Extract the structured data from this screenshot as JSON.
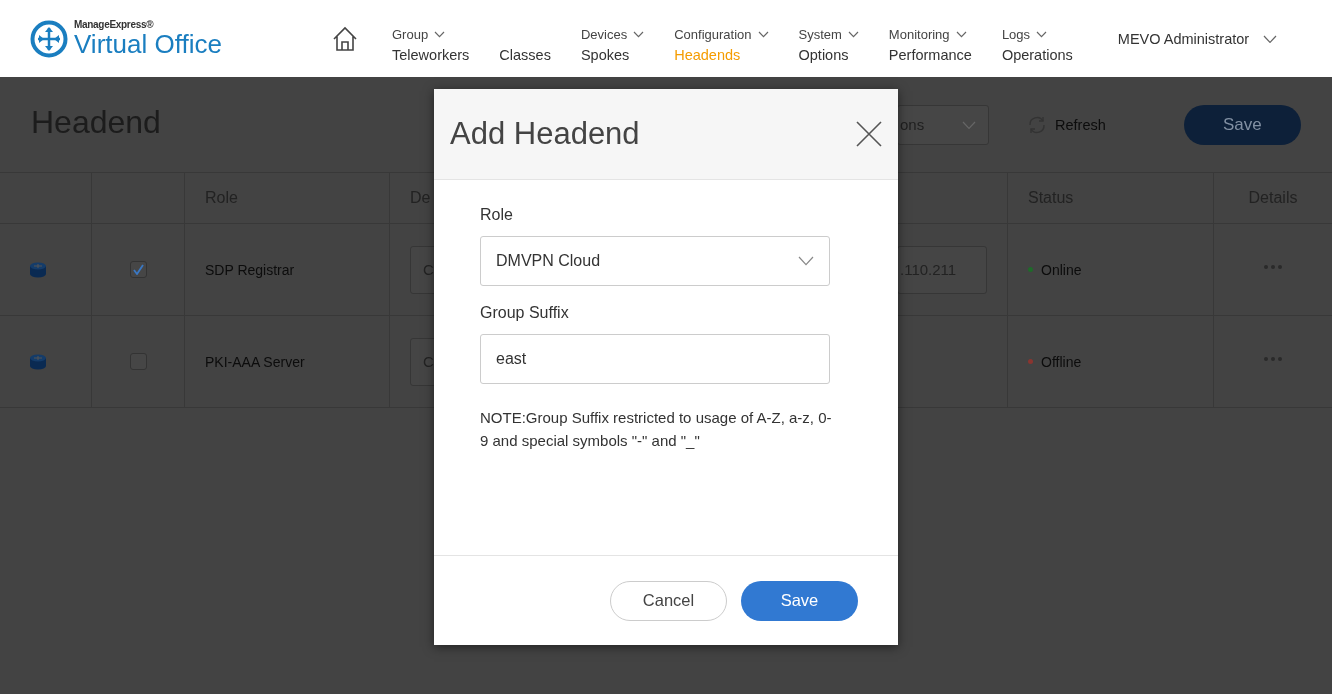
{
  "header": {
    "logo": {
      "brand": "ManageExpress®",
      "product": "Virtual Office"
    },
    "nav": [
      {
        "group": "Group",
        "label": "Teleworkers",
        "selected": false
      },
      {
        "label": "Classes",
        "selected": false
      },
      {
        "group": "Devices",
        "label": "Spokes",
        "selected": false
      },
      {
        "group": "Configuration",
        "label": "Headends",
        "selected": true
      },
      {
        "group": "System",
        "label": "Options",
        "selected": false
      },
      {
        "group": "Monitoring",
        "label": "Performance",
        "selected": false
      },
      {
        "group": "Logs",
        "label": "Operations",
        "selected": false
      }
    ],
    "user": "MEVO Administrator"
  },
  "page": {
    "title": "Headend",
    "filter": {
      "value": "ons"
    },
    "refresh": "Refresh",
    "save": "Save"
  },
  "table": {
    "columns": [
      {
        "label": "Role"
      },
      {
        "label": "De"
      },
      {
        "label": "Status"
      },
      {
        "label": "Details"
      }
    ],
    "rows": [
      {
        "checked": true,
        "role": "SDP Registrar",
        "device": "C",
        "address": ".110.211",
        "status": "Online",
        "color": "#1f6a2a"
      },
      {
        "checked": false,
        "role": "PKI-AAA Server",
        "device": "C",
        "status": "Offline",
        "color": "#8a3530"
      }
    ]
  },
  "dialog": {
    "title": "Add Headend",
    "fields": [
      {
        "kind": "select",
        "label": "Role",
        "value": "DMVPN Cloud"
      },
      {
        "kind": "text",
        "label": "Group Suffix",
        "value": "east"
      }
    ],
    "note": "NOTE:Group Suffix restricted to usage of A-Z, a-z, 0-9 and special symbols \"-\" and \"_\"",
    "buttons": [
      {
        "kind": "secondary",
        "label": "Cancel"
      },
      {
        "kind": "primary",
        "label": "Save"
      }
    ]
  }
}
